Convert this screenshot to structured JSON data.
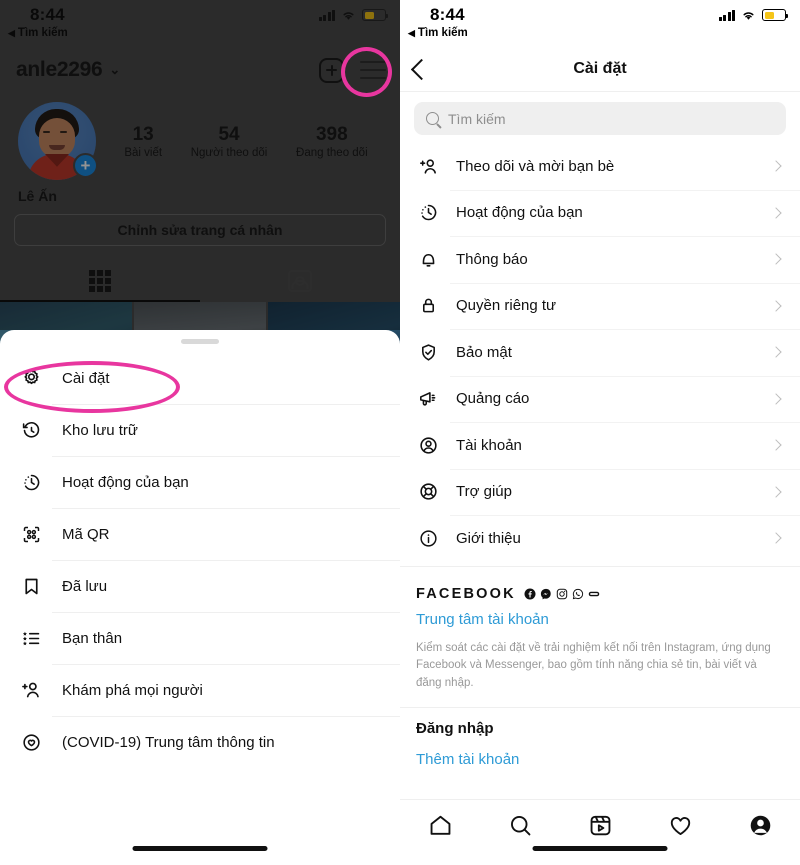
{
  "left_panel": {
    "status_bar": {
      "time": "8:44",
      "back_label": "Tìm kiếm",
      "back_arrow": "◀",
      "battery_icon": "battery-low-icon",
      "wifi_icon": "wifi-icon",
      "signal_icon": "signal-bars-icon"
    },
    "profile": {
      "username": "anle2296",
      "chevron": "⌄",
      "add_icon": "plus-box-icon",
      "menu_icon": "hamburger-menu-icon",
      "display_name": "Lê Ấn",
      "avatar_name": "profile-avatar",
      "add_story_icon": "add-story-plus-icon",
      "stats": [
        {
          "number": "13",
          "label": "Bài viết"
        },
        {
          "number": "54",
          "label": "Người theo dõi"
        },
        {
          "number": "398",
          "label": "Đang theo dõi"
        }
      ],
      "edit_button": "Chỉnh sửa trang cá nhân",
      "tabs": [
        {
          "name": "grid-tab",
          "icon": "grid-icon",
          "active": true
        },
        {
          "name": "tagged-tab",
          "icon": "tagged-person-icon",
          "active": false
        }
      ]
    },
    "sheet": {
      "grabber": "sheet-grabber",
      "items": [
        {
          "label": "Cài đặt",
          "icon": "gear-icon"
        },
        {
          "label": "Kho lưu trữ",
          "icon": "archive-clock-icon"
        },
        {
          "label": "Hoạt động của bạn",
          "icon": "activity-clock-icon"
        },
        {
          "label": "Mã QR",
          "icon": "qr-code-icon"
        },
        {
          "label": "Đã lưu",
          "icon": "bookmark-icon"
        },
        {
          "label": "Bạn thân",
          "icon": "close-friends-list-icon"
        },
        {
          "label": "Khám phá mọi người",
          "icon": "discover-people-icon"
        },
        {
          "label": "(COVID-19) Trung tâm thông tin",
          "icon": "covid-info-icon"
        }
      ]
    }
  },
  "right_panel": {
    "status_bar": {
      "time": "8:44",
      "back_label": "Tìm kiếm",
      "back_arrow": "◀",
      "battery_icon": "battery-low-icon",
      "wifi_icon": "wifi-icon",
      "signal_icon": "signal-bars-icon"
    },
    "nav": {
      "back_icon": "chevron-left-icon",
      "title": "Cài đặt"
    },
    "search": {
      "placeholder": "Tìm kiếm",
      "icon": "search-icon"
    },
    "items": [
      {
        "label": "Theo dõi và mời bạn bè",
        "icon": "add-person-icon"
      },
      {
        "label": "Hoạt động của bạn",
        "icon": "activity-clock-icon"
      },
      {
        "label": "Thông báo",
        "icon": "bell-icon"
      },
      {
        "label": "Quyền riêng tư",
        "icon": "lock-icon"
      },
      {
        "label": "Bảo mật",
        "icon": "shield-check-icon"
      },
      {
        "label": "Quảng cáo",
        "icon": "megaphone-icon"
      },
      {
        "label": "Tài khoản",
        "icon": "account-circle-icon"
      },
      {
        "label": "Trợ giúp",
        "icon": "lifebuoy-icon"
      },
      {
        "label": "Giới thiệu",
        "icon": "info-circle-icon"
      }
    ],
    "facebook_section": {
      "heading": "FACEBOOK",
      "brand_icons": [
        "facebook-icon",
        "messenger-icon",
        "instagram-icon",
        "whatsapp-icon",
        "oculus-icon"
      ],
      "link": "Trung tâm tài khoản",
      "description": "Kiểm soát các cài đặt về trải nghiệm kết nối trên Instagram, ứng dụng Facebook và Messenger, bao gồm tính năng chia sẻ tin, bài viết và đăng nhập."
    },
    "login_section": {
      "title": "Đăng nhập",
      "link": "Thêm tài khoản"
    },
    "tabbar": [
      {
        "name": "tab-home",
        "icon": "home-icon"
      },
      {
        "name": "tab-search",
        "icon": "search-icon"
      },
      {
        "name": "tab-reels",
        "icon": "reels-icon"
      },
      {
        "name": "tab-activity",
        "icon": "heart-icon"
      },
      {
        "name": "tab-profile",
        "icon": "profile-icon"
      }
    ]
  },
  "annotations": {
    "color": "#e8369f",
    "rings": [
      "hamburger-menu-highlight",
      "cai-dat-highlight",
      "quyen-rieng-tu-highlight"
    ]
  }
}
